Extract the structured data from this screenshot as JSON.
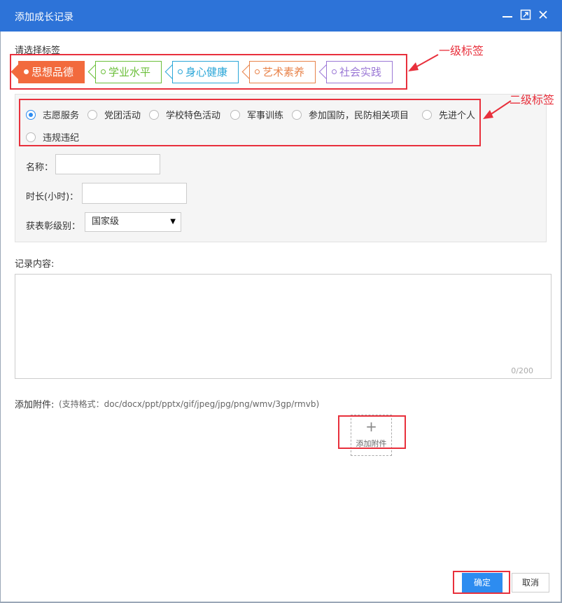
{
  "dialog": {
    "title": "添加成长记录"
  },
  "tags_section": {
    "label": "请选择标签",
    "items": [
      {
        "label": "思想品德",
        "color": "#f26a3d",
        "active": true
      },
      {
        "label": "学业水平",
        "color": "#6bbf3a",
        "active": false
      },
      {
        "label": "身心健康",
        "color": "#2aa6d8",
        "active": false
      },
      {
        "label": "艺术素养",
        "color": "#e8834a",
        "active": false
      },
      {
        "label": "社会实践",
        "color": "#9b78d6",
        "active": false
      }
    ]
  },
  "subtags": {
    "items": [
      {
        "label": "志愿服务",
        "checked": true
      },
      {
        "label": "党团活动",
        "checked": false
      },
      {
        "label": "学校特色活动",
        "checked": false
      },
      {
        "label": "军事训练",
        "checked": false
      },
      {
        "label": "参加国防，民防相关项目",
        "checked": false
      },
      {
        "label": "先进个人",
        "checked": false
      },
      {
        "label": "违规违纪",
        "checked": false
      }
    ]
  },
  "form": {
    "name_label": "名称：",
    "name_value": "",
    "duration_label": "时长(小时)：",
    "duration_value": "",
    "award_label": "获表彰级别：",
    "award_value": "国家级"
  },
  "content": {
    "label": "记录内容:",
    "value": "",
    "counter": "0/200"
  },
  "attachment": {
    "label": "添加附件:",
    "formats": "(支持格式：doc/docx/ppt/pptx/gif/jpeg/jpg/png/wmv/3gp/rmvb)",
    "button_label": "添加附件",
    "plus": "+"
  },
  "annotations": {
    "level1": "一级标签",
    "level2": "二级标签",
    "color": "#e8303c"
  },
  "footer": {
    "ok_label": "确定",
    "cancel_label": "取消"
  }
}
